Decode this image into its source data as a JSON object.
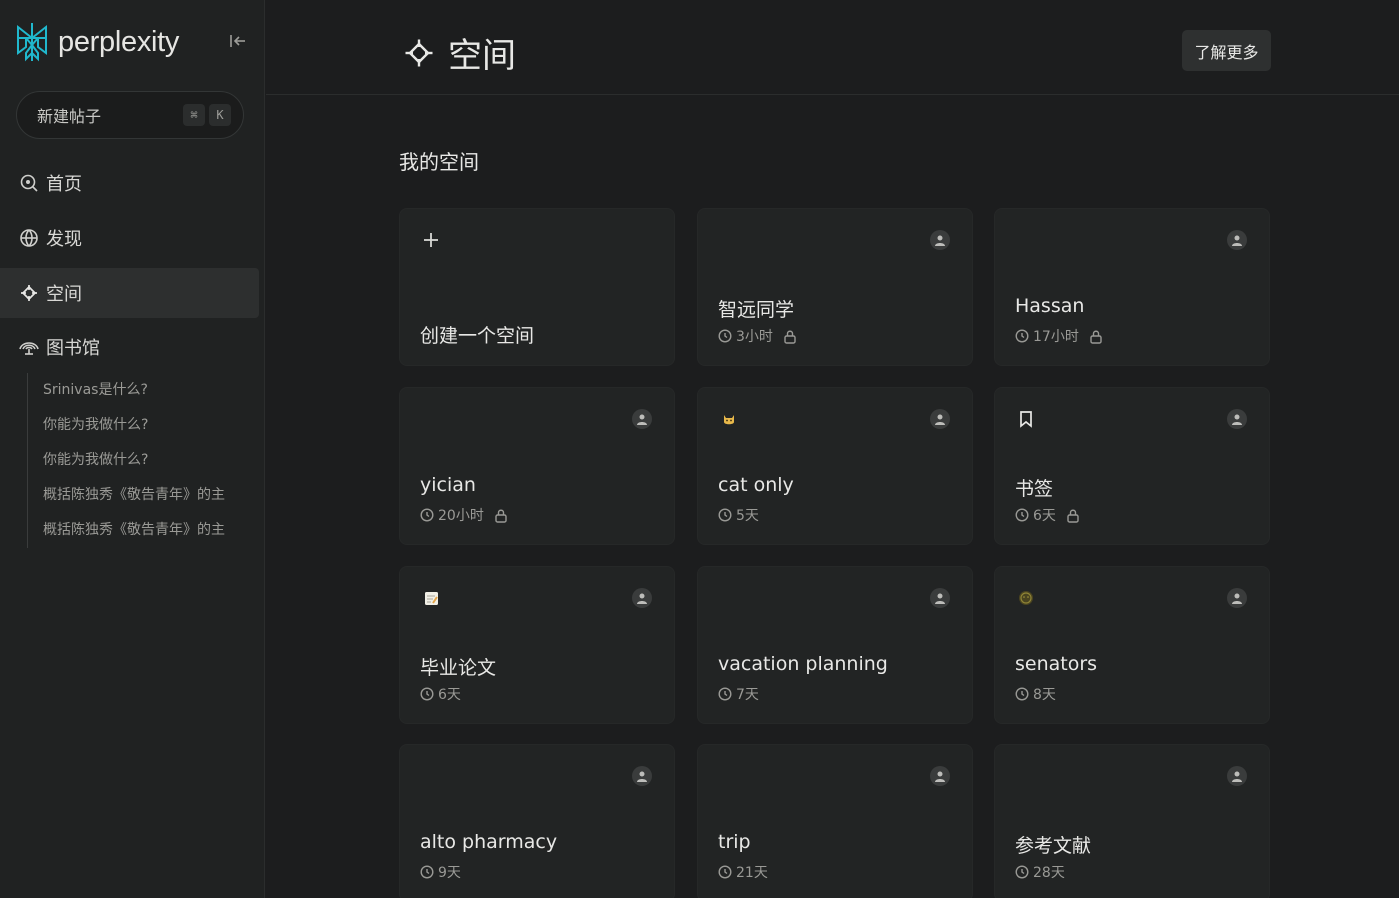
{
  "brand": {
    "name": "perplexity"
  },
  "sidebar": {
    "new_thread_label": "新建帖子",
    "shortcut_keys": [
      "⌘",
      "K"
    ],
    "nav": [
      {
        "label": "首页",
        "icon": "search-icon"
      },
      {
        "label": "发现",
        "icon": "globe-icon"
      },
      {
        "label": "空间",
        "icon": "spaces-icon",
        "active": true
      },
      {
        "label": "图书馆",
        "icon": "library-icon"
      }
    ],
    "library_items": [
      "Srinivas是什么?",
      "你能为我做什么?",
      "你能为我做什么?",
      "概括陈独秀《敬告青年》的主",
      "概括陈独秀《敬告青年》的主"
    ]
  },
  "header": {
    "title": "空间",
    "learn_more": "了解更多"
  },
  "section_title": "我的空间",
  "cards": [
    {
      "title": "创建一个空间",
      "type": "create",
      "icon": "plus-icon"
    },
    {
      "title": "智远同学",
      "time": "3小时",
      "locked": true
    },
    {
      "title": "Hassan",
      "time": "17小时",
      "locked": true
    },
    {
      "title": "yician",
      "time": "20小时",
      "locked": true
    },
    {
      "title": "cat only",
      "time": "5天",
      "locked": false,
      "icon": "cat-emoji-icon"
    },
    {
      "title": "书签",
      "time": "6天",
      "locked": true,
      "icon": "bookmark-icon"
    },
    {
      "title": "毕业论文",
      "time": "6天",
      "locked": false,
      "icon": "memo-emoji-icon"
    },
    {
      "title": "vacation planning",
      "time": "7天",
      "locked": false
    },
    {
      "title": "senators",
      "time": "8天",
      "locked": false,
      "icon": "smiley-emoji-icon"
    },
    {
      "title": "alto pharmacy",
      "time": "9天",
      "locked": false
    },
    {
      "title": "trip",
      "time": "21天",
      "locked": false
    },
    {
      "title": "参考文献",
      "time": "28天",
      "locked": false
    }
  ],
  "colors": {
    "background": "#1c1d1e",
    "sidebar": "#202222",
    "card": "#222424",
    "brand_accent": "#20b8cd"
  }
}
